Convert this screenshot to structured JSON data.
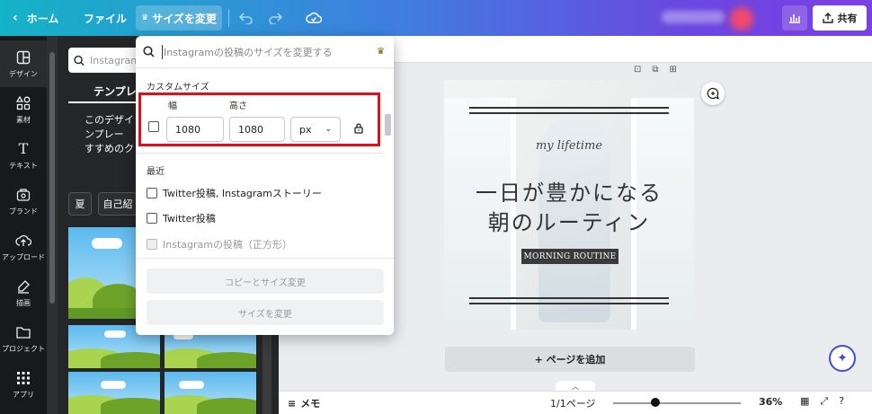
{
  "topbar": {
    "home": "ホーム",
    "file": "ファイル",
    "resize": "サイズを変更",
    "share": "共有"
  },
  "rail": [
    {
      "label": "デザイン",
      "icon": "layout-icon"
    },
    {
      "label": "素材",
      "icon": "shapes-icon"
    },
    {
      "label": "テキスト",
      "icon": "text-icon"
    },
    {
      "label": "ブランド",
      "icon": "brand-icon"
    },
    {
      "label": "アップロード",
      "icon": "upload-icon"
    },
    {
      "label": "描画",
      "icon": "draw-icon"
    },
    {
      "label": "プロジェクト",
      "icon": "folder-icon"
    },
    {
      "label": "アプリ",
      "icon": "apps-icon"
    }
  ],
  "panel": {
    "search_placeholder": "Instagram",
    "tab": "テンプレー",
    "desc": [
      "このデザイ",
      "ンプレー",
      "すすめのク"
    ],
    "chips": [
      "夏",
      "自己紹"
    ]
  },
  "dropdown": {
    "search_placeholder": "Instagramの投稿のサイズを変更する",
    "custom_size_heading": "カスタムサイズ",
    "width_label": "幅",
    "height_label": "高さ",
    "width_value": "1080",
    "height_value": "1080",
    "unit": "px",
    "recent_heading": "最近",
    "recent_items": [
      {
        "label": "Twitter投稿, Instagramストーリー",
        "disabled": false
      },
      {
        "label": "Twitter投稿",
        "disabled": false
      },
      {
        "label": "Instagramの投稿（正方形）",
        "disabled": true
      }
    ],
    "copy_resize_button": "コピーとサイズ変更",
    "resize_button": "サイズを変更"
  },
  "canvas": {
    "subtitle": "my lifetime",
    "title_line1": "一日が豊かになる",
    "title_line2": "朝のルーティン",
    "badge": "MORNING ROUTINE",
    "add_page": "+ ページを追加"
  },
  "bottombar": {
    "memo": "メモ",
    "page_indicator": "1/1ページ",
    "zoom": "36%",
    "zoom_fraction": 0.36
  },
  "colors": {
    "highlight": "#e0101a",
    "dark_rail": "#18191b",
    "panel": "#252627"
  }
}
